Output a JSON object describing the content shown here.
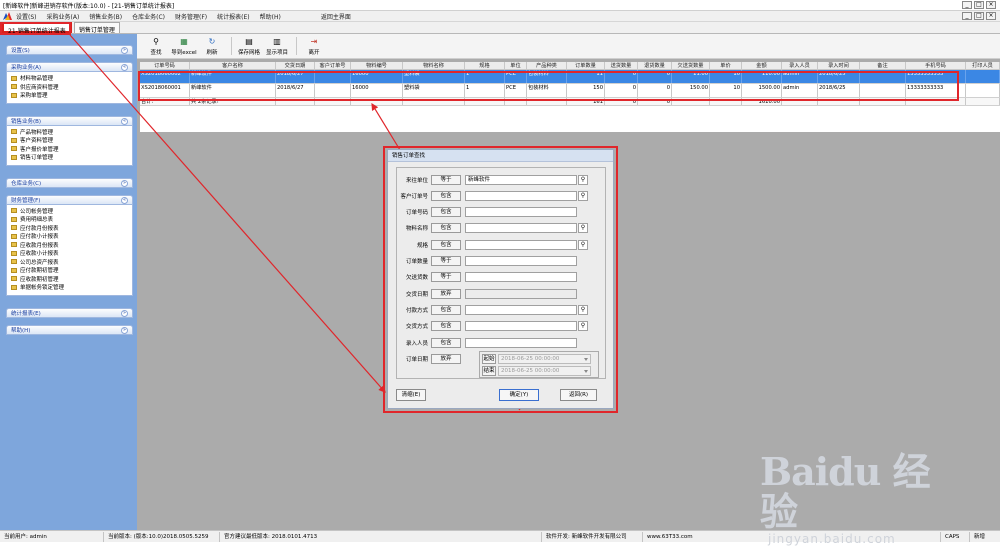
{
  "window": {
    "title": "[新峰软件]新峰进销存软件(版本:10.0) - [21-销售订单统计报表]",
    "controls": [
      "_",
      "□",
      "×"
    ]
  },
  "menubar": {
    "items": [
      "设置(S)",
      "采购业务(A)",
      "销售业务(B)",
      "仓库业务(C)",
      "财务管理(F)",
      "统计报表(E)",
      "帮助(H)"
    ],
    "return_label": "返回主界面",
    "controls": [
      "_",
      "□",
      "×"
    ]
  },
  "tabs": [
    "21-销售订单统计报表",
    "销售订单管理"
  ],
  "sidebar": {
    "sections": [
      {
        "title": "设置(S)",
        "items": []
      },
      {
        "title": "采购业务(A)",
        "items": [
          "材料物品管理",
          "供应商资料管理",
          "采购单管理"
        ]
      },
      {
        "title": "销售业务(B)",
        "items": [
          "产品物料管理",
          "客户资料管理",
          "客户报价单管理",
          "销售订单管理"
        ]
      },
      {
        "title": "仓库业务(C)",
        "items": []
      },
      {
        "title": "财务管理(F)",
        "items": [
          "公司帐务管理",
          "费用明细总表",
          "应付款月份报表",
          "应付款小计报表",
          "应收款月份报表",
          "应收款小计报表",
          "公司总资产报表",
          "应付款期初管理",
          "应收款期初管理",
          "单据帐务锁定管理"
        ]
      },
      {
        "title": "统计报表(E)",
        "items": []
      },
      {
        "title": "帮助(H)",
        "items": []
      }
    ]
  },
  "toolbar": {
    "buttons": [
      {
        "label": "查找",
        "icon": "binoculars-icon",
        "glyph": "⚲"
      },
      {
        "label": "导到excel",
        "icon": "excel-icon",
        "glyph": "▦"
      },
      {
        "label": "刷新",
        "icon": "refresh-icon",
        "glyph": "↻"
      },
      {
        "label": "保存网格",
        "icon": "save-grid-icon",
        "glyph": "▤"
      },
      {
        "label": "显示项目",
        "icon": "display-items-icon",
        "glyph": "▥"
      },
      {
        "label": "离开",
        "icon": "exit-icon",
        "glyph": "⇥"
      }
    ]
  },
  "grid": {
    "columns": [
      "订单号码",
      "客户名称",
      "交货日期",
      "客户订单号",
      "物料编号",
      "物料名称",
      "规格",
      "单位",
      "产品种类",
      "订单数量",
      "送货数量",
      "退货数量",
      "欠送货数量",
      "单价",
      "金额",
      "录入人员",
      "录入时间",
      "备注",
      "手机号码",
      "打印人员"
    ],
    "rows": [
      [
        "XS2018060002",
        "新峰软件",
        "2018/6/27",
        "",
        "16000",
        "塑料袋",
        "1",
        "PCE",
        "包装材料",
        "11",
        "0",
        "0",
        "11.00",
        "10",
        "110.00",
        "admin",
        "2018/6/25",
        "",
        "13333333333",
        ""
      ],
      [
        "XS2018060001",
        "新峰软件",
        "2018/6/27",
        "",
        "16000",
        "塑料袋",
        "1",
        "PCE",
        "包装材料",
        "150",
        "0",
        "0",
        "150.00",
        "10",
        "1500.00",
        "admin",
        "2018/6/25",
        "",
        "13333333333",
        ""
      ]
    ],
    "total_row": [
      "合计:",
      "共 2条记录!",
      "",
      "",
      "",
      "",
      "",
      "",
      "",
      "161",
      "0",
      "0",
      "",
      "",
      "1610.00",
      "",
      "",
      "",
      "",
      ""
    ]
  },
  "dialog": {
    "title": "销售订单查找",
    "fields": [
      {
        "label": "来往单位",
        "op": "等于",
        "value": "新峰软件",
        "search": true,
        "disabled": false
      },
      {
        "label": "客户订单号",
        "op": "包含",
        "value": "",
        "search": true,
        "disabled": false
      },
      {
        "label": "订单号码",
        "op": "包含",
        "value": "",
        "search": false,
        "disabled": false
      },
      {
        "label": "物料名称",
        "op": "包含",
        "value": "",
        "search": true,
        "disabled": false
      },
      {
        "label": "规格",
        "op": "包含",
        "value": "",
        "search": true,
        "disabled": false
      },
      {
        "label": "订单数量",
        "op": "等于",
        "value": "",
        "search": false,
        "disabled": false
      },
      {
        "label": "欠送货数",
        "op": "等于",
        "value": "",
        "search": false,
        "disabled": false
      },
      {
        "label": "交货日期",
        "op": "放弃",
        "value": "",
        "search": false,
        "disabled": true
      },
      {
        "label": "付款方式",
        "op": "包含",
        "value": "",
        "search": true,
        "disabled": false
      },
      {
        "label": "交货方式",
        "op": "包含",
        "value": "",
        "search": true,
        "disabled": false
      },
      {
        "label": "录入人员",
        "op": "包含",
        "value": "",
        "search": false,
        "disabled": false
      }
    ],
    "order_date": {
      "label": "订单日期",
      "op": "放弃",
      "start_label": "起始",
      "start_value": "2018-06-25 00:00:00",
      "end_label": "结束",
      "end_value": "2018-06-25 00:00:00"
    },
    "buttons": {
      "edit": "清缩(E)",
      "ok": "确定(Y)",
      "back": "返回(R)"
    }
  },
  "statusbar": {
    "user": "当前用户: admin",
    "version": "当前版本: (版本:10.0)2018.0505.5259",
    "recommended": "官方建议最低版本: 2018.0101.4713",
    "developer": "软件开发: 新峰软件开发有限公司",
    "website": "www.63T33.com",
    "caps": "CAPS",
    "mode": "新增"
  },
  "watermark": {
    "big": "Baidu 经验",
    "small": "jingyan.baidu.com"
  },
  "colors": {
    "sidebar": "#7ea6dc",
    "selected_row": "#3b87e4",
    "annotation_red": "#e0262b",
    "workspace": "#ababab"
  }
}
